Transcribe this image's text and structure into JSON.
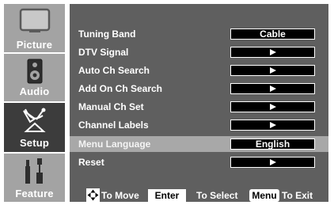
{
  "sidebar": {
    "tabs": [
      {
        "label": "Picture",
        "icon": "tv-screen-icon",
        "active": false
      },
      {
        "label": "Audio",
        "icon": "speaker-icon",
        "active": false
      },
      {
        "label": "Setup",
        "icon": "satellite-antenna-icon",
        "active": true
      },
      {
        "label": "Feature",
        "icon": "tools-icon",
        "active": false
      }
    ]
  },
  "menu": {
    "items": [
      {
        "label": "Tuning Band",
        "value": "Cable"
      },
      {
        "label": "DTV Signal",
        "value": ""
      },
      {
        "label": "Auto Ch Search",
        "value": ""
      },
      {
        "label": "Add On Ch Search",
        "value": ""
      },
      {
        "label": "Manual Ch Set",
        "value": ""
      },
      {
        "label": "Channel Labels",
        "value": ""
      },
      {
        "label": "Menu Language",
        "value": "English",
        "highlighted": true
      },
      {
        "label": "Reset",
        "value": ""
      }
    ]
  },
  "footer": {
    "move_label": "To Move",
    "enter_key": "Enter",
    "select_label": "To Select",
    "menu_key": "Menu",
    "exit_label": "To Exit"
  },
  "colors": {
    "panel_bg": "#5f5f5f",
    "highlight_bg": "#a8a8a8",
    "tab_inactive": "#a3a3a3",
    "tab_active": "#3c3c3c",
    "value_box_bg": "#000000"
  }
}
